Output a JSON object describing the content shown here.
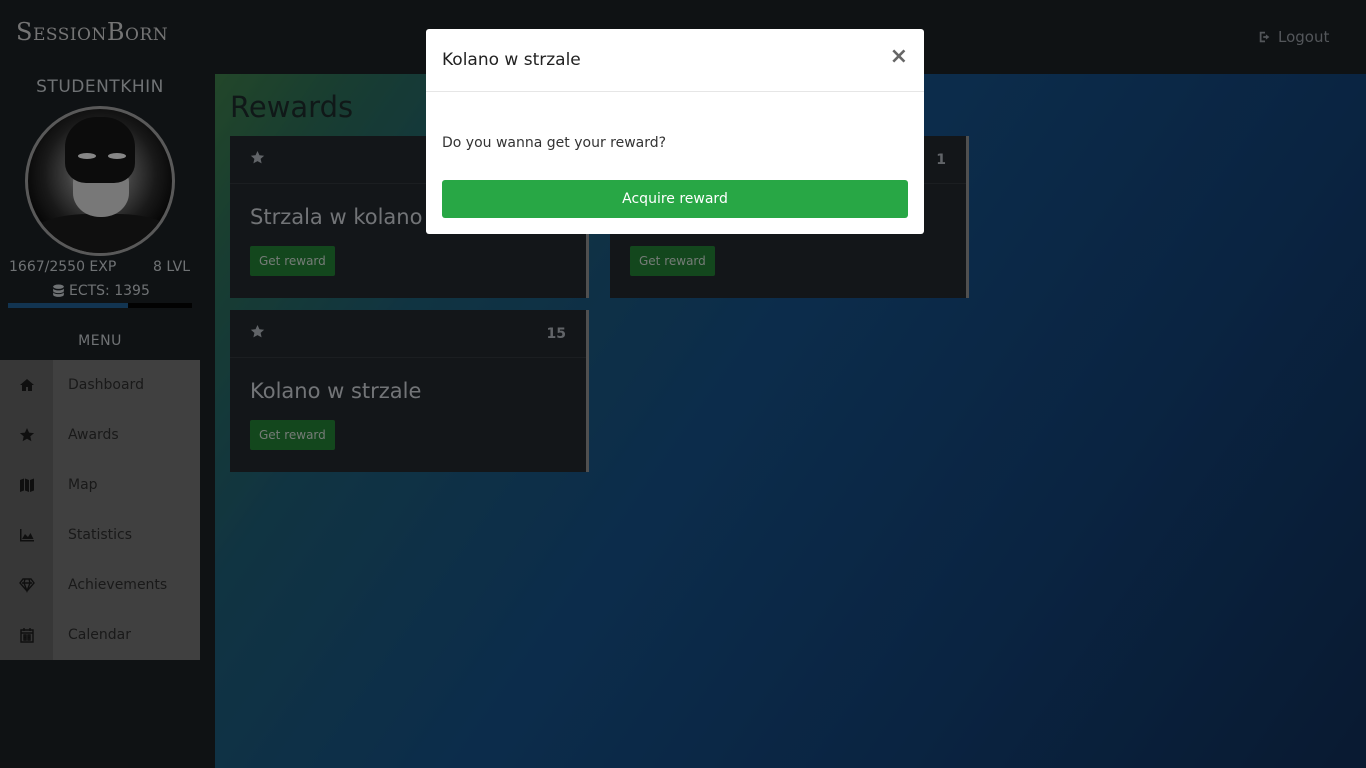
{
  "app": {
    "logo": "SessionBorn",
    "logout_label": "Logout"
  },
  "user": {
    "name": "STUDENTKHIN",
    "exp": "1667/2550 EXP",
    "level": "8 LVL",
    "ects": "ECTS: 1395",
    "exp_progress": 0.654
  },
  "menu": {
    "title": "MENU",
    "items": [
      {
        "label": "Dashboard",
        "icon": "home-icon"
      },
      {
        "label": "Awards",
        "icon": "star-icon"
      },
      {
        "label": "Map",
        "icon": "map-icon"
      },
      {
        "label": "Statistics",
        "icon": "area-chart-icon"
      },
      {
        "label": "Achievements",
        "icon": "diamond-icon"
      },
      {
        "label": "Calendar",
        "icon": "calendar-icon"
      }
    ]
  },
  "page": {
    "title": "Rewards",
    "cards": [
      {
        "title": "Strzala w kolano",
        "count": "",
        "button": "Get reward"
      },
      {
        "title": "",
        "count": "1",
        "button": "Get reward"
      },
      {
        "title": "Kolano w strzale",
        "count": "15",
        "button": "Get reward"
      }
    ]
  },
  "modal": {
    "title": "Kolano w strzale",
    "close": "×",
    "text": "Do you wanna get your reward?",
    "button": "Acquire reward"
  },
  "colors": {
    "accent_green": "#28a745",
    "card_button_green": "#227a33",
    "exp_bar": "#1f5a8c"
  }
}
